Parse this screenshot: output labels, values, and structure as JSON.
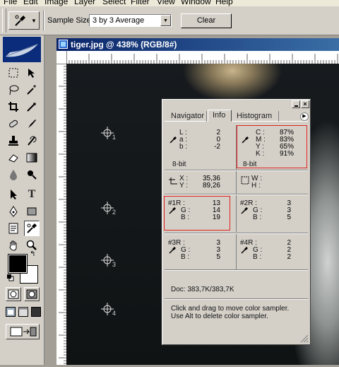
{
  "menu": [
    "File",
    "Edit",
    "Image",
    "Layer",
    "Select",
    "Filter",
    "View",
    "Window",
    "Help"
  ],
  "options": {
    "sample_size_label": "Sample Size:",
    "sample_size_value": "3 by 3 Average",
    "clear_label": "Clear"
  },
  "document": {
    "title": "tiger.jpg @ 438% (RGB/8#)",
    "samplers": [
      "1",
      "2",
      "3",
      "4"
    ]
  },
  "panel": {
    "tabs": [
      "Navigator",
      "Info",
      "Histogram"
    ],
    "active_tab": "Info",
    "lab": {
      "labels": [
        "L :",
        "a :",
        "b :"
      ],
      "values": [
        "2",
        "0",
        "-2"
      ],
      "bits": "8-bit"
    },
    "cmyk": {
      "labels": [
        "C :",
        "M :",
        "Y :",
        "K :"
      ],
      "values": [
        "87%",
        "83%",
        "65%",
        "91%"
      ],
      "bits": "8-bit"
    },
    "xy": {
      "labels": [
        "X :",
        "Y :"
      ],
      "values": [
        "35,36",
        "89,26"
      ]
    },
    "wh": {
      "labels": [
        "W :",
        "H :"
      ],
      "values": [
        "",
        ""
      ]
    },
    "s1": {
      "labels": [
        "#1R :",
        "G :",
        "B :"
      ],
      "values": [
        "13",
        "14",
        "19"
      ]
    },
    "s2": {
      "labels": [
        "#2R :",
        "G :",
        "B :"
      ],
      "values": [
        "3",
        "3",
        "5"
      ]
    },
    "s3": {
      "labels": [
        "#3R :",
        "G :",
        "B :"
      ],
      "values": [
        "3",
        "3",
        "5"
      ]
    },
    "s4": {
      "labels": [
        "#4R :",
        "G :",
        "B :"
      ],
      "values": [
        "2",
        "2",
        "2"
      ]
    },
    "doc_size": "Doc: 383,7K/383,7K",
    "help": [
      "Click and drag to move color sampler.",
      "Use Alt to delete color sampler."
    ]
  },
  "colors": {
    "highlight": "#e0201c",
    "titlebar": "#0a246a",
    "panel_bg": "#d4d0c8"
  }
}
